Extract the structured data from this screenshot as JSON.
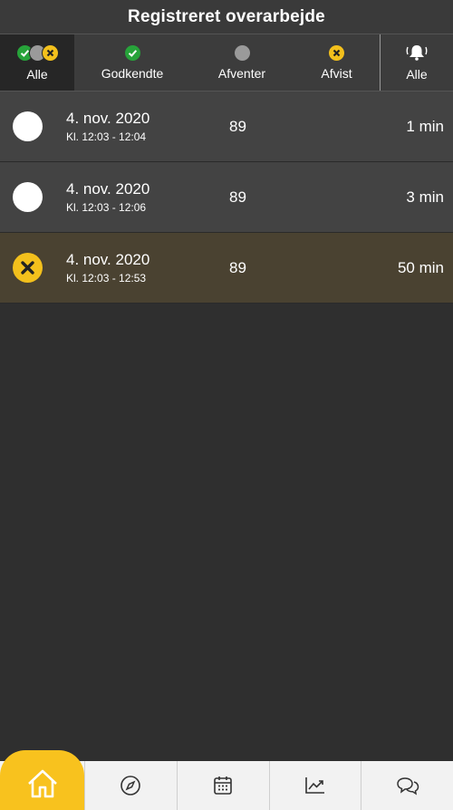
{
  "header": {
    "title": "Registreret overarbejde"
  },
  "filters": {
    "all_label": "Alle",
    "approved_label": "Godkendte",
    "pending_label": "Afventer",
    "rejected_label": "Afvist",
    "notifications_label": "Alle"
  },
  "colors": {
    "approved": "#27a33a",
    "pending": "#9a9a9a",
    "rejected": "#f3c01c",
    "accent": "#f8c21e"
  },
  "entries": [
    {
      "date": "4. nov. 2020",
      "time": "Kl. 12:03 - 12:04",
      "count": "89",
      "duration": "1 min",
      "status": "pending"
    },
    {
      "date": "4. nov. 2020",
      "time": "Kl. 12:03 - 12:06",
      "count": "89",
      "duration": "3 min",
      "status": "pending"
    },
    {
      "date": "4. nov. 2020",
      "time": "Kl. 12:03 - 12:53",
      "count": "89",
      "duration": "50 min",
      "status": "rejected"
    }
  ],
  "nav": {
    "items": [
      {
        "icon": "home-icon"
      },
      {
        "icon": "compass-icon"
      },
      {
        "icon": "calendar-icon"
      },
      {
        "icon": "trend-chart-icon"
      },
      {
        "icon": "chat-icon"
      }
    ]
  }
}
